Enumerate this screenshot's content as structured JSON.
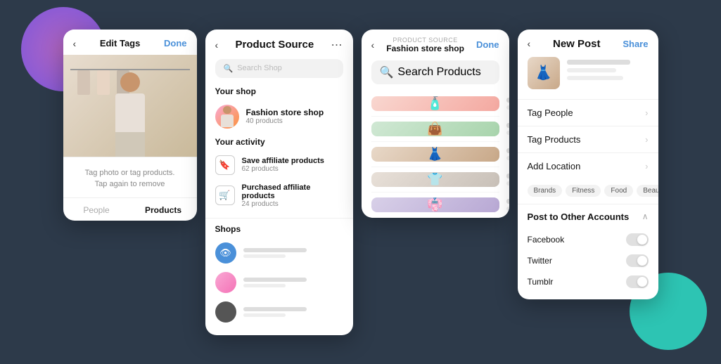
{
  "screen1": {
    "header": {
      "back_label": "‹",
      "title": "Edit Tags",
      "done_label": "Done"
    },
    "caption": {
      "line1": "Tag photo or tag products.",
      "line2": "Tap again to remove"
    },
    "tabs": [
      {
        "label": "People",
        "active": false
      },
      {
        "label": "Products",
        "active": true
      }
    ]
  },
  "screen2": {
    "header": {
      "back_label": "‹",
      "title": "Product Source",
      "menu_label": "⋯"
    },
    "search": {
      "placeholder": "Search Shop"
    },
    "your_shop_label": "Your shop",
    "shop": {
      "name": "Fashion store shop",
      "sub": "40 products"
    },
    "your_activity_label": "Your activity",
    "activities": [
      {
        "icon": "🔖",
        "name": "Save affiliate products",
        "sub": "62 products"
      },
      {
        "icon": "🛒",
        "name": "Purchased affiliate products",
        "sub": "24 products"
      }
    ],
    "shops_label": "Shops"
  },
  "screen3": {
    "header": {
      "back_label": "‹",
      "small_label": "PRODUCT SOURCE",
      "shop_title": "Fashion store shop",
      "done_label": "Done"
    },
    "search": {
      "placeholder": "Search Products"
    },
    "products": [
      {
        "thumb_type": "perfume",
        "emoji": "🧴"
      },
      {
        "thumb_type": "bag",
        "emoji": "👜"
      },
      {
        "thumb_type": "person",
        "emoji": "👗"
      },
      {
        "thumb_type": "shirt",
        "emoji": "👕"
      },
      {
        "thumb_type": "outfit",
        "emoji": "👘"
      }
    ]
  },
  "screen4": {
    "header": {
      "back_label": "‹",
      "title": "New Post",
      "share_label": "Share"
    },
    "post_thumb_emoji": "👗",
    "options": [
      {
        "label": "Tag People",
        "has_chevron": true
      },
      {
        "label": "Tag Products",
        "has_chevron": true
      }
    ],
    "add_location": {
      "label": "Add Location",
      "has_chevron": true
    },
    "location_tags": [
      "Brands",
      "Fitness",
      "Food",
      "Beauty"
    ],
    "other_accounts": {
      "label": "Post to Other Accounts",
      "social": [
        {
          "name": "Facebook",
          "on": false
        },
        {
          "name": "Twitter",
          "on": false
        },
        {
          "name": "Tumblr",
          "on": false
        }
      ]
    }
  }
}
